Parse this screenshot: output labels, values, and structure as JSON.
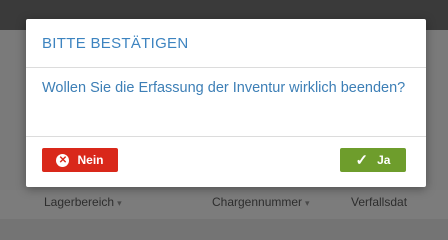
{
  "background": {
    "columns": [
      "Lagerbereich",
      "Chargennummer",
      "Verfallsdat"
    ]
  },
  "dialog": {
    "title": "BITTE BESTÄTIGEN",
    "message": "Wollen Sie die Erfassung der Inventur wirklich beenden?",
    "buttons": {
      "no": {
        "label": "Nein",
        "icon": "close-circle-icon",
        "color": "#d9281a"
      },
      "yes": {
        "label": "Ja",
        "icon": "check-icon",
        "color": "#6e9d2c"
      }
    }
  },
  "colors": {
    "accent": "#3d84c0",
    "overlay": "#747474"
  }
}
